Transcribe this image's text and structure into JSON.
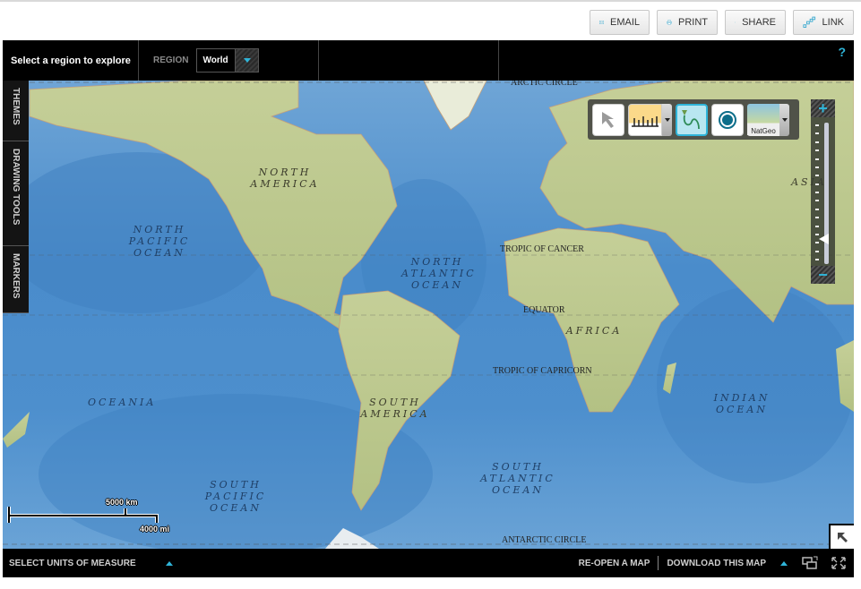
{
  "share_bar": {
    "email": "EMAIL",
    "print": "PRINT",
    "share": "SHARE",
    "link": "LINK"
  },
  "header": {
    "title": "Select a region to explore",
    "region_label": "REGION",
    "region_value": "World",
    "help": "?"
  },
  "side_tabs": [
    "THEMES",
    "DRAWING TOOLS",
    "MARKERS"
  ],
  "toolbox": {
    "tools": [
      "select-tool",
      "measure-tool",
      "draw-line-tool",
      "marker-tool"
    ],
    "active_tool": "draw-line-tool",
    "basemap_label": "NatGeo"
  },
  "zoom": {
    "in": "+",
    "out": "−",
    "level_fraction": 0.15
  },
  "map_labels": {
    "continents": {
      "north_america": "NORTH AMERICA",
      "south_america": "SOUTH AMERICA",
      "africa": "AFRICA",
      "asia": "ASIA",
      "oceania": "OCEANIA"
    },
    "oceans": {
      "north_pacific": "NORTH PACIFIC OCEAN",
      "north_atlantic": "NORTH ATLANTIC OCEAN",
      "south_pacific": "SOUTH PACIFIC OCEAN",
      "south_atlantic": "SOUTH ATLANTIC OCEAN",
      "indian": "INDIAN OCEAN"
    },
    "lines": {
      "arctic": "ARCTIC CIRCLE",
      "cancer": "TROPIC OF CANCER",
      "equator": "EQUATOR",
      "capricorn": "TROPIC OF CAPRICORN",
      "antarctic": "ANTARCTIC CIRCLE"
    }
  },
  "scale_bar": {
    "km": "5000 km",
    "mi": "4000 mi"
  },
  "footer": {
    "units": "SELECT UNITS OF MEASURE",
    "reopen": "RE-OPEN A MAP",
    "download": "DOWNLOAD THIS MAP"
  }
}
